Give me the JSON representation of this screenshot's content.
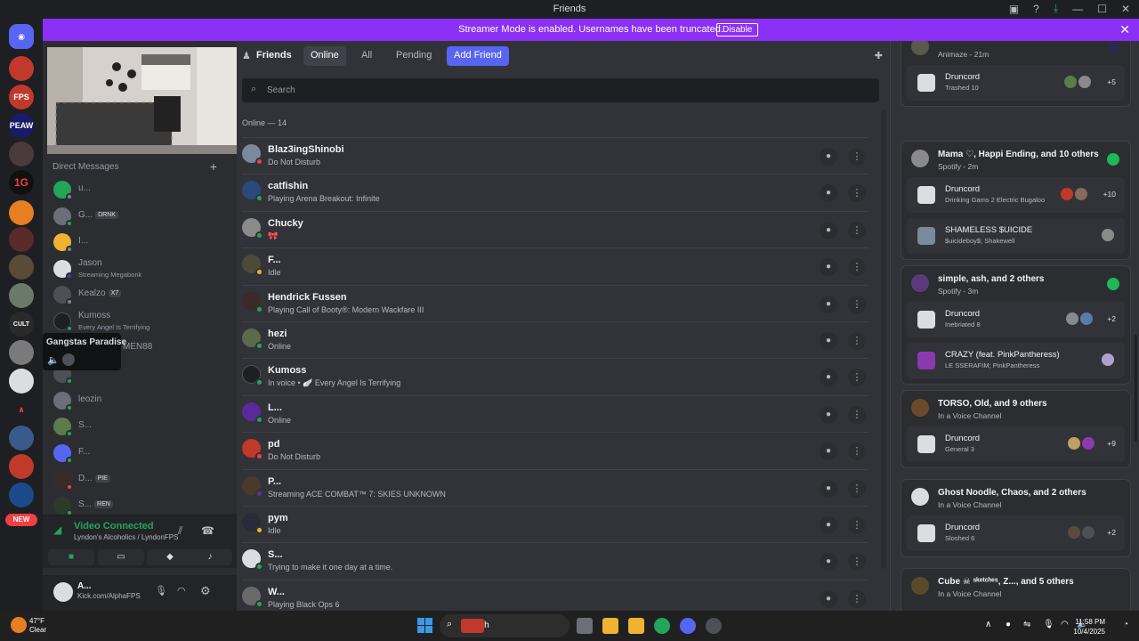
{
  "window": {
    "title": "Friends"
  },
  "banner": {
    "message": "Streamer Mode is enabled. Usernames have been truncated.",
    "disable_label": "Disable"
  },
  "guilds": {
    "new_badge": "NEW",
    "labels": [
      "FPS",
      "PEAW",
      "1G",
      "CULT"
    ]
  },
  "sidebar": {
    "dm_header": "Direct Messages",
    "dms": [
      {
        "name": "u...",
        "color": "#23a55a",
        "status": "#80848e"
      },
      {
        "name": "G...",
        "tag": "DRNK",
        "color": "#6d6f78",
        "status": "#23a55a"
      },
      {
        "name": "I...",
        "color": "#f0b232",
        "status": "#80848e"
      },
      {
        "name": "Jason",
        "sub": "Streaming Megabonk",
        "color": "#dbdee1",
        "status": "#593695"
      },
      {
        "name": "Kealzo",
        "tag": "X7",
        "color": "#4e5058",
        "status": "#80848e"
      },
      {
        "name": "Kumoss",
        "sub": "Every Angel Is Terrifying",
        "color": "#1e1f22",
        "status": "#23a55a"
      },
      {
        "name": "MEN88",
        "color": "#4e5058",
        "status": "#23a55a"
      },
      {
        "name": "",
        "color": "#4e5058",
        "status": "#23a55a"
      },
      {
        "name": "leozin",
        "color": "#6d6f78",
        "status": "#23a55a"
      },
      {
        "name": "S...",
        "color": "#5a7d4a",
        "status": "#23a55a"
      },
      {
        "name": "F...",
        "color": "#5865f2",
        "status": "#23a55a"
      },
      {
        "name": "D...",
        "tag": "PIE",
        "color": "#3b2a2a",
        "status": "#f23f43"
      },
      {
        "name": "S...",
        "tag": "REN",
        "color": "#2a3b2a",
        "status": "#23a55a"
      }
    ],
    "tooltip": "Gangstas Paradise",
    "voice": {
      "status": "Video Connected",
      "channel": "Lyndon's Alcoholics / LyndonFPS"
    },
    "user": {
      "name": "A...",
      "status": "Kick.com/AlphaFPS"
    }
  },
  "tabs": {
    "friends": "Friends",
    "online": "Online",
    "all": "All",
    "pending": "Pending",
    "add": "Add Friend"
  },
  "search": {
    "placeholder": "Search"
  },
  "online_header": "Online — 14",
  "friends": [
    {
      "name": "Blaz3ingShinobi",
      "sub": "Do Not Disturb",
      "color": "#7a8a9a",
      "status": "#f23f43"
    },
    {
      "name": "catfishin",
      "sub": "Playing Arena Breakout: Infinite",
      "color": "#2a4a7a",
      "status": "#23a55a"
    },
    {
      "name": "Chucky",
      "sub": "🎀",
      "color": "#8a8a8a",
      "status": "#23a55a"
    },
    {
      "name": "F...",
      "sub": "Idle",
      "color": "#4e4a3a",
      "status": "#f0b232"
    },
    {
      "name": "Hendrick Fussen",
      "sub": "Playing Call of Booty®: Modern Wackfare III",
      "color": "#3a2a2a",
      "status": "#23a55a"
    },
    {
      "name": "hezi",
      "sub": "Online",
      "color": "#5a6a4a",
      "status": "#23a55a"
    },
    {
      "name": "Kumoss",
      "sub": "In voice • 🪽 Every Angel Is Terrifying",
      "color": "#1e1f22",
      "status": "#23a55a"
    },
    {
      "name": "L...",
      "sub": "Online",
      "color": "#5a2a9a",
      "status": "#23a55a"
    },
    {
      "name": "pd",
      "sub": "Do Not Disturb",
      "color": "#c0392b",
      "status": "#f23f43"
    },
    {
      "name": "P...",
      "sub": "Streaming ACE COMBAT™ 7: SKIES UNKNOWN",
      "color": "#4a3a2a",
      "status": "#593695"
    },
    {
      "name": "pym",
      "sub": "Idle",
      "color": "#2a2a3a",
      "status": "#f0b232"
    },
    {
      "name": "S...",
      "sub": "Trying to make it one day at a time.",
      "color": "#dbdee1",
      "status": "#23a55a"
    },
    {
      "name": "W...",
      "sub": "Playing Black Ops 6",
      "color": "#6a6a6a",
      "status": "#23a55a"
    }
  ],
  "activity": {
    "cards": [
      {
        "title": "",
        "sub": "Animaze - 21m",
        "rows": [
          {
            "name": "Druncord",
            "sub": "Trashed 10",
            "count": "+5"
          }
        ]
      },
      {
        "title": "Mama ♡, Happi Ending, and 10 others",
        "sub": "Spotify - 2m",
        "rows": [
          {
            "name": "Druncord",
            "sub": "Drinking Gams 2 Electric Bugaloo",
            "count": "+10"
          },
          {
            "name": "SHAMELESS $UICIDE",
            "sub": "$uicideboy$; Shakewell",
            "count": ""
          }
        ]
      },
      {
        "title": "simple, ash, and 2 others",
        "sub": "Spotify - 3m",
        "rows": [
          {
            "name": "Druncord",
            "sub": "Inebriated 8",
            "count": "+2"
          },
          {
            "name": "CRAZY (feat. PinkPantheress)",
            "sub": "LE SSERAFIM; PinkPantheress",
            "count": ""
          }
        ]
      },
      {
        "title": "TORSO, Old, and 9 others",
        "sub": "In a Voice Channel",
        "rows": [
          {
            "name": "Druncord",
            "sub": "General 3",
            "count": "+9"
          }
        ]
      },
      {
        "title": "Ghost Noodle, Chaos, and 2 others",
        "sub": "In a Voice Channel",
        "rows": [
          {
            "name": "Druncord",
            "sub": "Sloshed 6",
            "count": "+2"
          }
        ]
      },
      {
        "title": "Cube ☠ ˢᵏᵉᵗᶜʰᵉˢ, Z..., and 5 others",
        "sub": "In a Voice Channel",
        "rows": []
      }
    ]
  },
  "taskbar": {
    "temp": "47°F",
    "condition": "Clear",
    "search": "Search",
    "time": "11:58 PM",
    "date": "10/4/2025"
  },
  "colors": {
    "accent": "#5865f2",
    "banner": "#8c30f5",
    "online": "#23a55a",
    "dnd": "#f23f43",
    "idle": "#f0b232",
    "spotify": "#1db954"
  }
}
